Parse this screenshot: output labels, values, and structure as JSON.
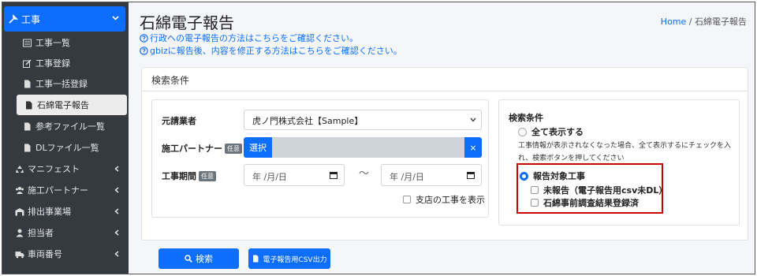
{
  "sidebar": {
    "top": {
      "label": "工事",
      "icon": "tool-icon"
    },
    "sub_items": [
      {
        "label": "工事一覧",
        "icon": "list-icon"
      },
      {
        "label": "工事登録",
        "icon": "edit-icon"
      },
      {
        "label": "工事一括登録",
        "icon": "file-icon"
      },
      {
        "label": "石綿電子報告",
        "icon": "file-icon",
        "active": true
      },
      {
        "label": "参考ファイル一覧",
        "icon": "file-icon"
      },
      {
        "label": "DLファイル一覧",
        "icon": "file-icon"
      }
    ],
    "groups": [
      {
        "label": "マニフェスト",
        "icon": "recycle-icon"
      },
      {
        "label": "施工パートナー",
        "icon": "users-icon"
      },
      {
        "label": "排出事業場",
        "icon": "warehouse-icon"
      },
      {
        "label": "担当者",
        "icon": "user-icon"
      },
      {
        "label": "車両番号",
        "icon": "truck-icon"
      }
    ]
  },
  "header": {
    "title": "石綿電子報告",
    "link1": "行政への電子報告の方法はこちらをご確認ください。",
    "link2": "gbizに報告後、内容を修正する方法はこちらをご確認ください。",
    "breadcrumb_home": "Home",
    "breadcrumb_sep": "/",
    "breadcrumb_current": "石綿電子報告"
  },
  "search": {
    "card_title": "検索条件",
    "contractor_label": "元請業者",
    "contractor_value": "虎ノ門株式会社【Sample】",
    "partner_label": "施工パートナー",
    "optional_badge": "任意",
    "select_button": "選択",
    "clear_button": "×",
    "period_label": "工事期間",
    "date_placeholder": "年 /月/日",
    "tilde": "〜",
    "branch_checkbox": "支店の工事を表示"
  },
  "conditions": {
    "title": "検索条件",
    "show_all": "全て表示する",
    "note": "工事情報が表示されなくなった場合、全て表示するにチェックを入れ、検索ボタンを押してください",
    "report_target": "報告対象工事",
    "unreported": "未報告（電子報告用csv未DL）",
    "registered": "石綿事前調査結果登録済"
  },
  "actions": {
    "search_button": "検索",
    "csv_button": "電子報告用CSV出力"
  },
  "colors": {
    "sidebar_bg": "#343a40",
    "accent": "#0d6efd",
    "highlight": "#cc0000"
  }
}
